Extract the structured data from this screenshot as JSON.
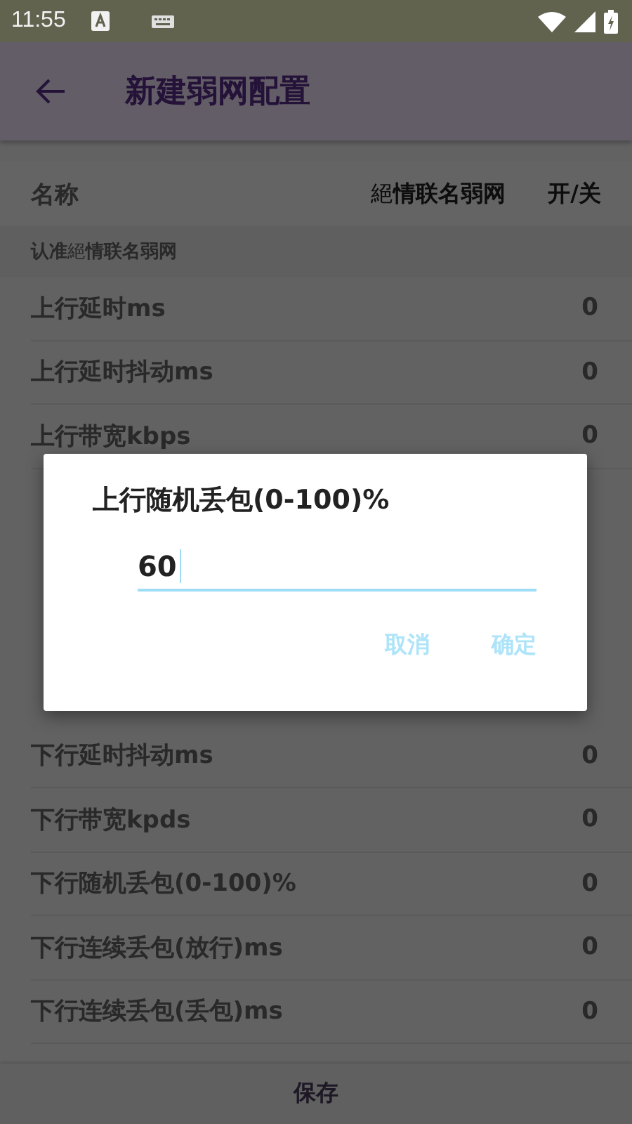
{
  "status_bar": {
    "time": "11:55"
  },
  "app_bar": {
    "title": "新建弱网配置"
  },
  "header": {
    "name_label": "名称",
    "profile": "絕**情联名弱网**",
    "toggle_label": "开/关"
  },
  "section": {
    "title": "**认准**絕**情联名弱网**"
  },
  "upper_rows": [
    {
      "label": "上行延时ms",
      "value": "0"
    },
    {
      "label": "上行延时抖动ms",
      "value": "0"
    },
    {
      "label": "上行带宽kbps",
      "value": "0"
    }
  ],
  "lower_rows": [
    {
      "label": "下行延时抖动ms",
      "value": "0"
    },
    {
      "label": "下行带宽kpds",
      "value": "0"
    },
    {
      "label": "下行随机丢包(0-100)%",
      "value": "0"
    },
    {
      "label": "下行连续丢包(放行)ms",
      "value": "0"
    },
    {
      "label": "下行连续丢包(丢包)ms",
      "value": "0"
    }
  ],
  "footer": {
    "button": "保存"
  },
  "dialog": {
    "title": "上行随机丢包(0-100)%",
    "input": {
      "value": "60",
      "focused": true
    },
    "buttons": [
      {
        "label": "取消"
      },
      {
        "label": "确定"
      }
    ]
  }
}
